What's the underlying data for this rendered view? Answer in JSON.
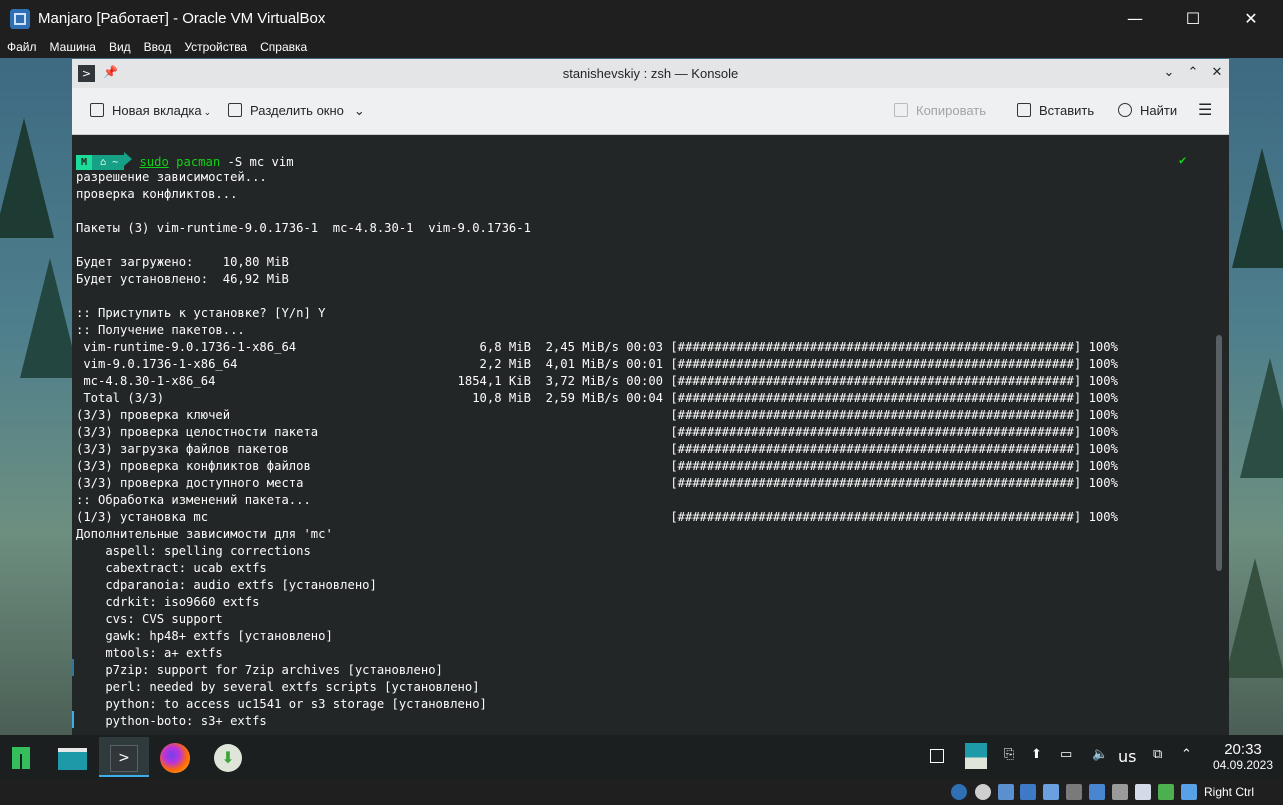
{
  "host": {
    "title": "Manjaro [Работает] - Oracle VM VirtualBox",
    "controls": {
      "minimize": "—",
      "maximize": "☐",
      "close": "✕"
    },
    "menu": [
      "Файл",
      "Машина",
      "Вид",
      "Ввод",
      "Устройства",
      "Справка"
    ],
    "host_key": "Right Ctrl"
  },
  "konsole": {
    "title": "stanishevskiy : zsh — Konsole",
    "toolbar": {
      "new_tab": "Новая вкладка",
      "split": "Разделить окно",
      "copy": "Копировать",
      "paste": "Вставить",
      "find": "Найти"
    }
  },
  "terminal": {
    "prompt": {
      "logo": "M",
      "dir": "⌂ ~",
      "cmd_sudo": "sudo",
      "cmd_pacman": "pacman",
      "cmd_args": " -S mc vim",
      "status": "✔"
    },
    "lines": [
      "разрешение зависимостей...",
      "проверка конфликтов...",
      "",
      "Пакеты (3) vim-runtime-9.0.1736-1  mc-4.8.30-1  vim-9.0.1736-1",
      "",
      "Будет загружено:    10,80 MiB",
      "Будет установлено:  46,92 MiB",
      "",
      ":: Приступить к установке? [Y/n] Y",
      ":: Получение пакетов...",
      " vim-runtime-9.0.1736-1-x86_64                         6,8 MiB  2,45 MiB/s 00:03 [######################################################] 100%",
      " vim-9.0.1736-1-x86_64                                 2,2 MiB  4,01 MiB/s 00:01 [######################################################] 100%",
      " mc-4.8.30-1-x86_64                                 1854,1 KiB  3,72 MiB/s 00:00 [######################################################] 100%",
      " Total (3/3)                                          10,8 MiB  2,59 MiB/s 00:04 [######################################################] 100%",
      "(3/3) проверка ключей                                                            [######################################################] 100%",
      "(3/3) проверка целостности пакета                                                [######################################################] 100%",
      "(3/3) загрузка файлов пакетов                                                    [######################################################] 100%",
      "(3/3) проверка конфликтов файлов                                                 [######################################################] 100%",
      "(3/3) проверка доступного места                                                  [######################################################] 100%",
      ":: Обработка изменений пакета...",
      "(1/3) установка mc                                                               [######################################################] 100%",
      "Дополнительные зависимости для 'mc'",
      "    aspell: spelling corrections",
      "    cabextract: ucab extfs",
      "    cdparanoia: audio extfs [установлено]",
      "    cdrkit: iso9660 extfs",
      "    cvs: CVS support",
      "    gawk: hp48+ extfs [установлено]",
      "    mtools: a+ extfs",
      "    p7zip: support for 7zip archives [установлено]",
      "    perl: needed by several extfs scripts [установлено]",
      "    python: to access uc1541 or s3 storage [установлено]",
      "    python-boto: s3+ extfs"
    ]
  },
  "taskbar": {
    "apps": [
      "manjaro-menu-icon",
      "file-manager-icon",
      "konsole-icon",
      "firefox-icon",
      "downloader-icon"
    ],
    "keyboard_layout": "us",
    "time": "20:33",
    "date": "04.09.2023"
  },
  "colors": {
    "terminal_bg": "#232627",
    "prompt_green": "#1cdc9a",
    "prompt_teal": "#16a085",
    "cmd_green": "#11d116",
    "accent": "#3daee9"
  }
}
